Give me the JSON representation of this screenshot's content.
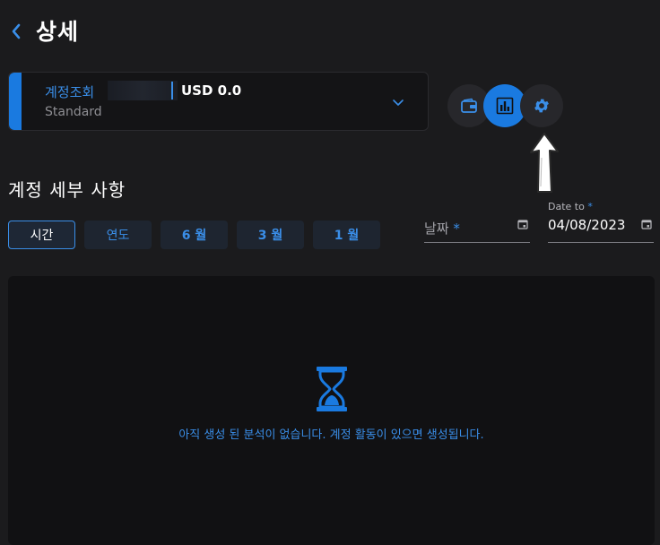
{
  "header": {
    "title": "상세"
  },
  "account": {
    "name": "계정조회",
    "balance": "USD 0.0",
    "type": "Standard"
  },
  "icons": {
    "back": "chevron-left-icon",
    "wallet": "wallet-icon",
    "analytics": "bar-chart-icon",
    "settings": "gear-icon",
    "dropdown": "chevron-down-icon",
    "calendar": "calendar-icon",
    "empty": "hourglass-icon"
  },
  "section": {
    "title": "계정 세부 사항"
  },
  "periods": [
    {
      "label": "시간",
      "active": true
    },
    {
      "label": "연도",
      "active": false
    },
    {
      "label": "6 월",
      "active": false
    },
    {
      "label": "3 월",
      "active": false
    },
    {
      "label": "1 월",
      "active": false
    }
  ],
  "date_from": {
    "placeholder": "날짜",
    "required_mark": "*"
  },
  "date_to": {
    "label": "Date to",
    "required_mark": "*",
    "value": "04/08/2023"
  },
  "empty_state": {
    "message": "아직 생성 된 분석이 없습니다. 계정 활동이 있으면 생성됩니다."
  },
  "colors": {
    "background": "#1b1b1d",
    "accent": "#1a7ae0",
    "link": "#3a8ee8",
    "panel": "#111113"
  }
}
